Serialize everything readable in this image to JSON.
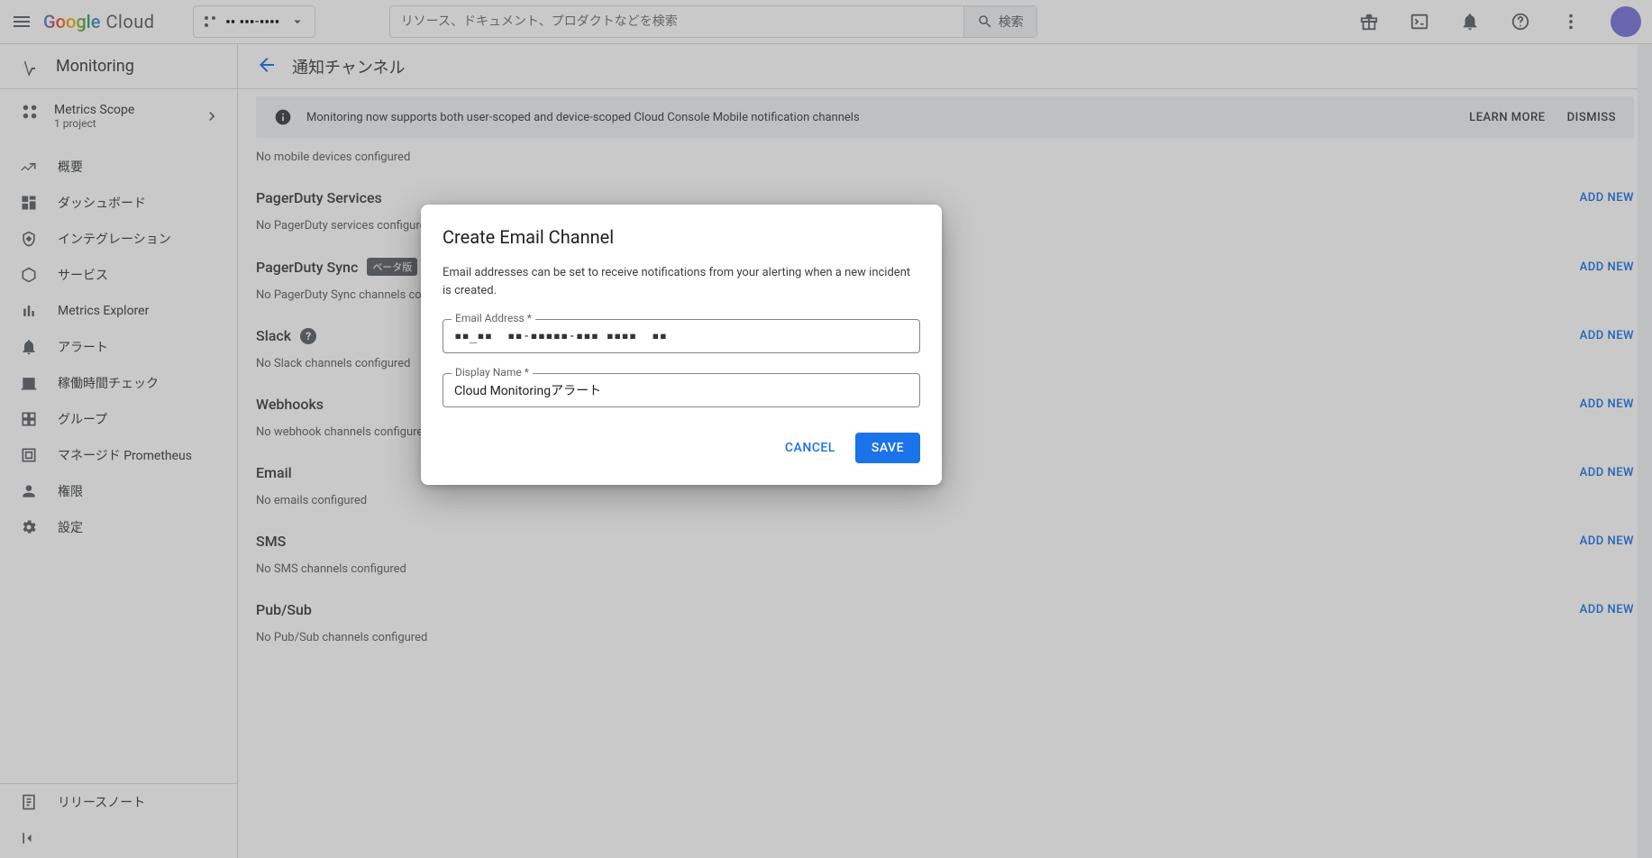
{
  "header": {
    "logo_google": "Google",
    "logo_cloud": "Cloud",
    "project_name": "▪▪ ▪▪▪-▪▪▪▪",
    "search_placeholder": "リソース、ドキュメント、プロダクトなどを検索",
    "search_btn": "検索"
  },
  "sidebar": {
    "product": "Monitoring",
    "scope_title": "Metrics Scope",
    "scope_sub": "1 project",
    "items": [
      "概要",
      "ダッシュボード",
      "インテグレーション",
      "サービス",
      "Metrics Explorer",
      "アラート",
      "稼働時間チェック",
      "グループ",
      "マネージド Prometheus",
      "権限",
      "設定"
    ],
    "release_notes": "リリースノート"
  },
  "page": {
    "title": "通知チャンネル",
    "banner_text": "Monitoring now supports both user-scoped and device-scoped Cloud Console Mobile notification channels",
    "banner_learn": "LEARN MORE",
    "banner_dismiss": "DISMISS",
    "no_mobile": "No mobile devices configured",
    "add_new": "ADD NEW",
    "sections": [
      {
        "title": "PagerDuty Services",
        "note": "No PagerDuty services configured"
      },
      {
        "title": "PagerDuty Sync",
        "badge": "ベータ版",
        "note": "No PagerDuty Sync channels configured"
      },
      {
        "title": "Slack",
        "help": true,
        "note": "No Slack channels configured"
      },
      {
        "title": "Webhooks",
        "note": "No webhook channels configured"
      },
      {
        "title": "Email",
        "note": "No emails configured"
      },
      {
        "title": "SMS",
        "note": "No SMS channels configured"
      },
      {
        "title": "Pub/Sub",
        "note": "No Pub/Sub channels configured"
      }
    ]
  },
  "modal": {
    "title": "Create Email Channel",
    "desc": "Email addresses can be set to receive notifications from your alerting when a new incident is created.",
    "email_label": "Email Address *",
    "email_value": "▪▪_▪▪  ▪▪-▪▪▪▪▪-▪▪▪ ▪▪▪▪  ▪▪",
    "name_label": "Display Name *",
    "name_value": "Cloud Monitoringアラート",
    "cancel": "CANCEL",
    "save": "SAVE"
  }
}
